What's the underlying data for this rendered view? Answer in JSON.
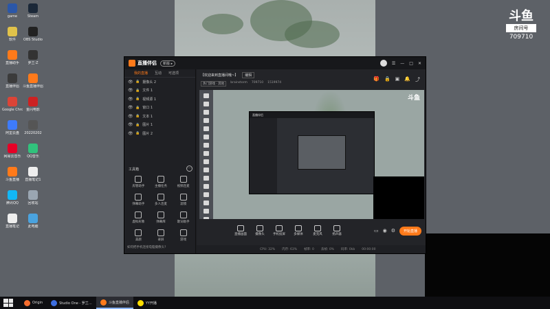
{
  "watermark": {
    "logo": "斗鱼",
    "box": "房间号",
    "room": "709710"
  },
  "desktop_icons": [
    {
      "label": "game",
      "color": "#2b57a8"
    },
    {
      "label": "Steam",
      "color": "#1b2838"
    },
    {
      "label": "软件",
      "color": "#e0c24a"
    },
    {
      "label": "OBS Studio",
      "color": "#222222"
    },
    {
      "label": "直播助手",
      "color": "#ff7a1a"
    },
    {
      "label": "罗兰·Z",
      "color": "#333333"
    },
    {
      "label": "直播伴侣",
      "color": "#3b3b3b"
    },
    {
      "label": "斗鱼直播伴侣",
      "color": "#ff7a1a"
    },
    {
      "label": "Google Chrome",
      "color": "#db4437"
    },
    {
      "label": "金闪电影",
      "color": "#cc2222"
    },
    {
      "label": "阿里云盘",
      "color": "#3e7bfa"
    },
    {
      "label": "20220202",
      "color": "#555555"
    },
    {
      "label": "网易云音乐",
      "color": "#e60026"
    },
    {
      "label": "QQ音乐",
      "color": "#31c27c"
    },
    {
      "label": "斗鱼直播",
      "color": "#ff7a1a"
    },
    {
      "label": "直播笔记1",
      "color": "#eeeeee"
    },
    {
      "label": "腾讯QQ",
      "color": "#12b7f5"
    },
    {
      "label": "回收站",
      "color": "#9aa6b2"
    },
    {
      "label": "直播笔记",
      "color": "#eeeeee"
    },
    {
      "label": "此电脑",
      "color": "#4aa3df"
    }
  ],
  "window": {
    "app_name": "直播伴侣",
    "version": "新版 ▸",
    "tabs": [
      "我的直播",
      "互动",
      "可选项"
    ],
    "scenes": [
      "摄像头 2",
      "文件 1",
      "视频源 1",
      "窗口 1",
      "文本 1",
      "图片 1",
      "图片 2"
    ],
    "tools_title": "工具箱",
    "tools": [
      "房管助手",
      "主播任务",
      "视频连麦",
      "弹幕助手",
      "多人连麦",
      "滤镜",
      "虚拟形象",
      "弹幕库",
      "歌词助手",
      "美颜",
      "录屏",
      "游戏"
    ],
    "left_footer": "如何把手机连接电脑摄像头?",
    "room": {
      "title": "【欢迎来到直播间哦~】",
      "edit": "编辑",
      "category": "热门游戏 · 其他",
      "streamer": "brainstorm",
      "room_id": "709710",
      "followers": "1519974"
    },
    "bottom_tools": [
      "直播画面",
      "摄像头",
      "手机投屏",
      "多媒体",
      "麦克风",
      "扬声器"
    ],
    "start_label": "开始直播",
    "status": [
      "CPU: 32%",
      "内存: 63%",
      "帧率: 0",
      "丢帧: 0%",
      "码率: 0kb",
      "00:00:00"
    ]
  },
  "taskbar": [
    {
      "label": "Origin",
      "color": "#f56c2d",
      "active": false
    },
    {
      "label": "Studio One - 罗兰…",
      "color": "#3d6ee0",
      "active": false
    },
    {
      "label": "斗鱼直播伴侣",
      "color": "#ff7a1a",
      "active": true
    },
    {
      "label": "YY开播",
      "color": "#ffde00",
      "active": false
    }
  ]
}
